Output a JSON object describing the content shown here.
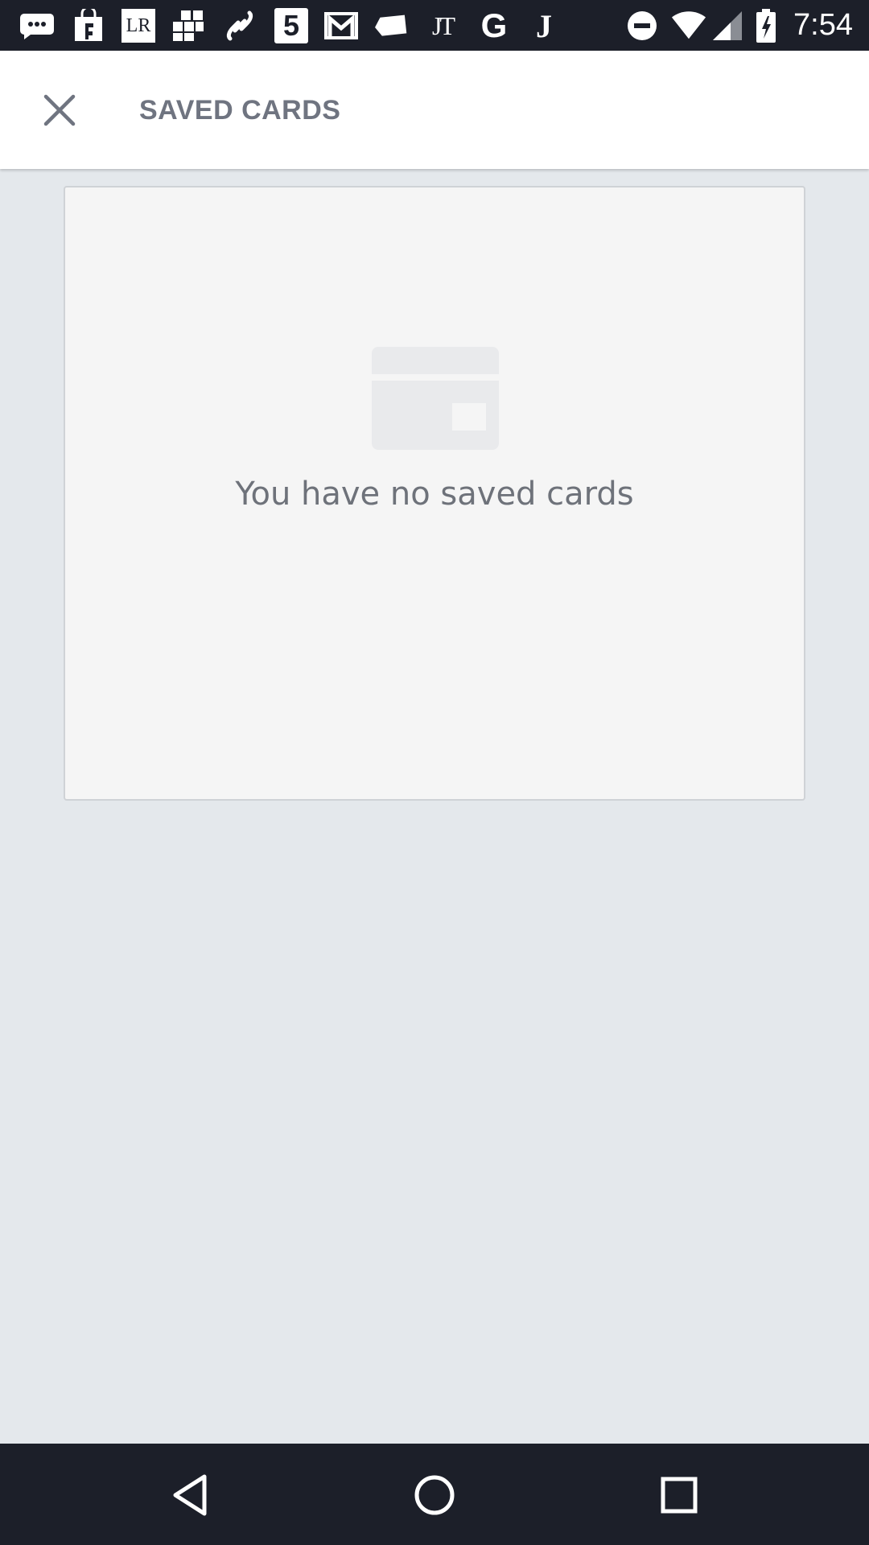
{
  "status_bar": {
    "time": "7:54",
    "lr_badge": "LR",
    "five_badge": "5",
    "jt_badge": "JT",
    "g_badge": "G",
    "j_badge": "J",
    "left_icons": [
      "messages-icon",
      "shopping-bag-icon",
      "lr-app-icon",
      "grid-app-icon",
      "link-app-icon",
      "five-app-icon",
      "gmail-icon",
      "tag-icon",
      "jt-app-icon",
      "google-icon",
      "j-app-icon"
    ],
    "right_icons": [
      "do-not-disturb-icon",
      "wifi-icon",
      "cell-signal-icon",
      "battery-charging-icon"
    ]
  },
  "header": {
    "title": "SAVED CARDS",
    "close_icon": "close-icon"
  },
  "empty_state": {
    "icon": "credit-card-icon",
    "message": "You have no saved cards"
  },
  "nav_bar": {
    "icons": [
      "back-icon",
      "home-icon",
      "recents-icon"
    ]
  },
  "colors": {
    "background": "#e4e8ec",
    "appbar": "#ffffff",
    "system_bars": "#1c1f29",
    "title_text": "#6f7480",
    "panel": "#f5f5f5"
  }
}
